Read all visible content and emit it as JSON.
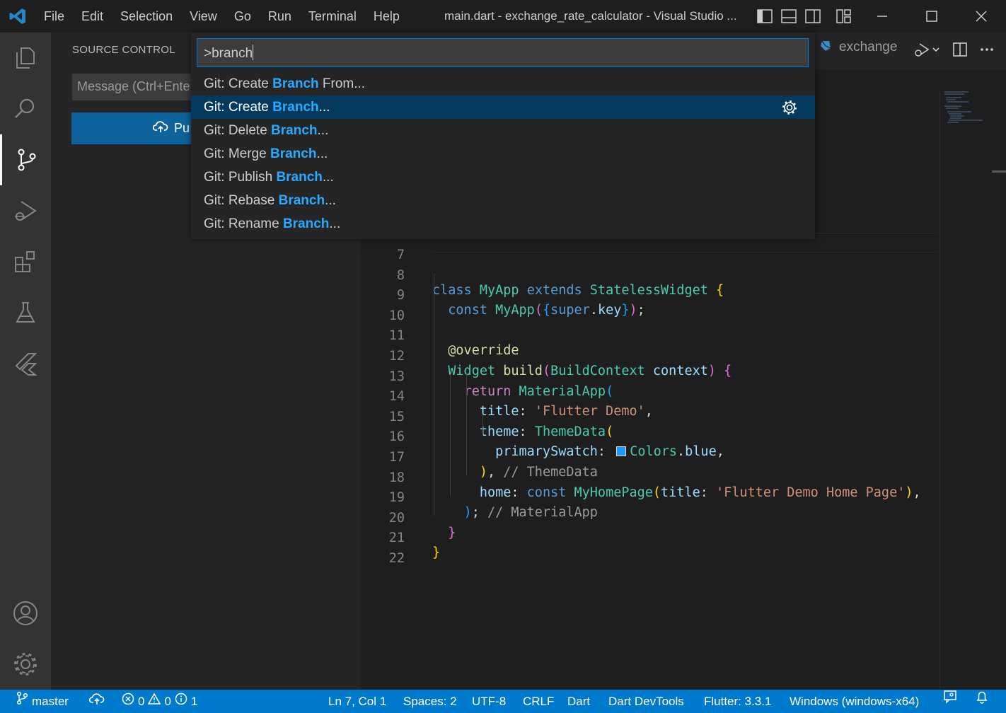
{
  "titlebar": {
    "menu": [
      "File",
      "Edit",
      "Selection",
      "View",
      "Go",
      "Run",
      "Terminal",
      "Help"
    ],
    "window_title": "main.dart - exchange_rate_calculator - Visual Studio ..."
  },
  "sidebar": {
    "title": "SOURCE CONTROL",
    "message_placeholder": "Message (Ctrl+Ente",
    "publish_button_label": "Pu"
  },
  "editor": {
    "tab_label": "exchange",
    "lines": [
      {
        "n": "7"
      },
      {
        "n": "8"
      },
      {
        "n": "9"
      },
      {
        "n": "10"
      },
      {
        "n": "11"
      },
      {
        "n": "12"
      },
      {
        "n": "13"
      },
      {
        "n": "14"
      },
      {
        "n": "15"
      },
      {
        "n": "16"
      },
      {
        "n": "17"
      },
      {
        "n": "18"
      },
      {
        "n": "19"
      },
      {
        "n": "20"
      },
      {
        "n": "21"
      },
      {
        "n": "22"
      }
    ],
    "code": {
      "l8": [
        "class",
        "MyApp",
        "extends",
        "StatelessWidget",
        "{"
      ],
      "l9": [
        "const",
        "MyApp",
        "(",
        "{",
        "super",
        ".",
        "key",
        "}",
        ")",
        ";"
      ],
      "l11": [
        "@override"
      ],
      "l12": [
        "Widget",
        "build",
        "(",
        "BuildContext",
        "context",
        ")",
        "{"
      ],
      "l13": [
        "return",
        "MaterialApp",
        "("
      ],
      "l14": [
        "title",
        ":",
        "'Flutter Demo'",
        ","
      ],
      "l15": [
        "theme",
        ":",
        "ThemeData",
        "("
      ],
      "l16": [
        "primarySwatch",
        ":",
        "Colors",
        ".",
        "blue",
        ","
      ],
      "l17": [
        ")",
        ",",
        "// ThemeData"
      ],
      "l18": [
        "home",
        ":",
        "const",
        "MyHomePage",
        "(",
        "title",
        ":",
        "'Flutter Demo Home Page'",
        ")",
        ","
      ],
      "l19": [
        ")",
        ";",
        "// MaterialApp"
      ],
      "l20": [
        "}"
      ],
      "l21": [
        "}"
      ]
    },
    "swatch_color": "#2196f3"
  },
  "palette": {
    "query": ">branch",
    "items": [
      {
        "pre": "Git: Create ",
        "hl": "Branch",
        "post": " From..."
      },
      {
        "pre": "Git: Create ",
        "hl": "Branch",
        "post": "..."
      },
      {
        "pre": "Git: Delete ",
        "hl": "Branch",
        "post": "..."
      },
      {
        "pre": "Git: Merge ",
        "hl": "Branch",
        "post": "..."
      },
      {
        "pre": "Git: Publish ",
        "hl": "Branch",
        "post": "..."
      },
      {
        "pre": "Git: Rebase ",
        "hl": "Branch",
        "post": "..."
      },
      {
        "pre": "Git: Rename ",
        "hl": "Branch",
        "post": "..."
      }
    ],
    "selected_index": 1
  },
  "statusbar": {
    "branch": "master",
    "errors": "0",
    "warnings": "0",
    "info": "1",
    "cursor": "Ln 7, Col 1",
    "spaces": "Spaces: 2",
    "encoding": "UTF-8",
    "eol": "CRLF",
    "language": "Dart",
    "devtools": "Dart DevTools",
    "flutter": "Flutter: 3.3.1",
    "device": "Windows (windows-x64)"
  },
  "colors": {
    "accent": "#007acc",
    "selection": "#04395e",
    "match_highlight": "#2aaaff",
    "button": "#0e639c"
  }
}
